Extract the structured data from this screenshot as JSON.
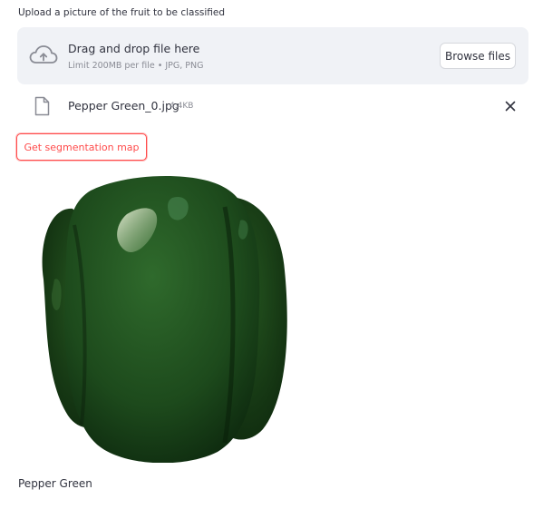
{
  "uploader": {
    "label": "Upload a picture of the fruit to be classified",
    "drop_title": "Drag and drop file here",
    "drop_subtitle": "Limit 200MB per file • JPG, PNG",
    "browse_label": "Browse files",
    "icon": "cloud-upload-icon"
  },
  "uploaded_file": {
    "name": "Pepper Green_0.jpg",
    "size": "4.4KB",
    "icon": "file-icon",
    "remove_icon": "close-icon"
  },
  "actions": {
    "segmentation_button": "Get segmentation map"
  },
  "result": {
    "label": "Pepper Green"
  },
  "colors": {
    "accent": "#ff4b4b",
    "dropzone_bg": "#f0f2f6",
    "text": "#31333f",
    "muted": "#8a8c95",
    "pepper": "#1e4a1e"
  }
}
